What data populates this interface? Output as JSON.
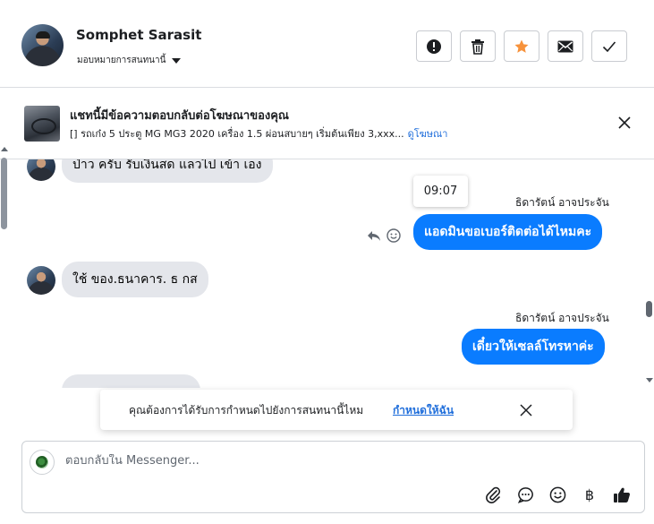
{
  "header": {
    "contact_name": "Somphet Sarasit",
    "assign_label": "มอบหมายการสนทนานี้",
    "actions": [
      {
        "name": "report",
        "icon": "exclamation-circle-icon"
      },
      {
        "name": "delete",
        "icon": "trash-icon"
      },
      {
        "name": "star",
        "icon": "star-icon",
        "color": "#f7923b"
      },
      {
        "name": "mark-unread",
        "icon": "envelope-icon"
      },
      {
        "name": "mark-done",
        "icon": "checkmark-icon"
      }
    ]
  },
  "ad": {
    "title": "แชทนี้มีข้อความตอบกลับต่อโฆษณาของคุณ",
    "subtitle": "[] รถเก๋ง 5 ประตู MG MG3 2020 เครื่อง 1.5 ผ่อนสบายๆ เริ่มต้นเพียง 3,xxx...",
    "link": "ดูโฆษณา"
  },
  "messages": [
    {
      "direction": "in",
      "text": "ป่าว ครับ รับเงินสด แลวไป เข้า เอง"
    },
    {
      "direction": "out",
      "sender": "ธิดารัตน์ อาจประจัน",
      "text": "แอดมินขอเบอร์ติดต่อได้ไหมคะ",
      "time": "09:07"
    },
    {
      "direction": "in",
      "text": "ใช้ ของ.ธนาคาร. ธ กส"
    },
    {
      "direction": "out",
      "sender": "ธิดารัตน์ อาจประจัน",
      "text": "เดี๋ยวให้เซลล์โทรหาค่ะ"
    }
  ],
  "reminder": {
    "text": "คุณต้องการได้รับการกำหนดไปยังการสนทนานี้ไหม",
    "link": "กำหนดให้ฉัน"
  },
  "composer": {
    "placeholder": "ตอบกลับใน Messenger...",
    "tools": [
      "attach-icon",
      "saved-reply-icon",
      "emoji-icon",
      "baht-payment-icon",
      "like-icon"
    ],
    "baht_symbol": "฿"
  },
  "colors": {
    "accent": "#0a7cff",
    "link": "#216fdb",
    "star": "#f7923b",
    "incoming_bubble": "#e4e6eb"
  }
}
